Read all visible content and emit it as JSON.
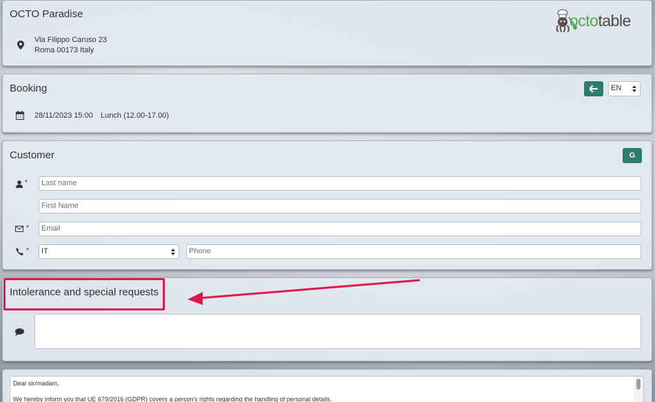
{
  "restaurant": {
    "name": "OCTO Paradise",
    "address_line1": "Via Filippo Caruso 23",
    "address_line2": "Roma 00173 Italy",
    "logo_text_part1": "octo",
    "logo_text_part2": "table"
  },
  "booking": {
    "title": "Booking",
    "date_time": "28/11/2023 15:00",
    "service": "Lunch (12.00-17.00)",
    "language": "EN"
  },
  "customer": {
    "title": "Customer",
    "google_button_label": "G",
    "required_mark": "*",
    "last_name_placeholder": "Last name",
    "first_name_placeholder": "First Name",
    "email_placeholder": "Email",
    "country_code": "IT",
    "phone_placeholder": "Phone"
  },
  "requests": {
    "title": "Intolerance and special requests",
    "textarea_value": ""
  },
  "privacy": {
    "greeting": "Dear sir/madam,",
    "line1": "We hereby inform you that UE 679/2016 (GDPR) covers a person's rights regarding the handling of personal details."
  },
  "colors": {
    "accent_green": "#2a7c6d",
    "annotation_red": "#e0194d"
  }
}
